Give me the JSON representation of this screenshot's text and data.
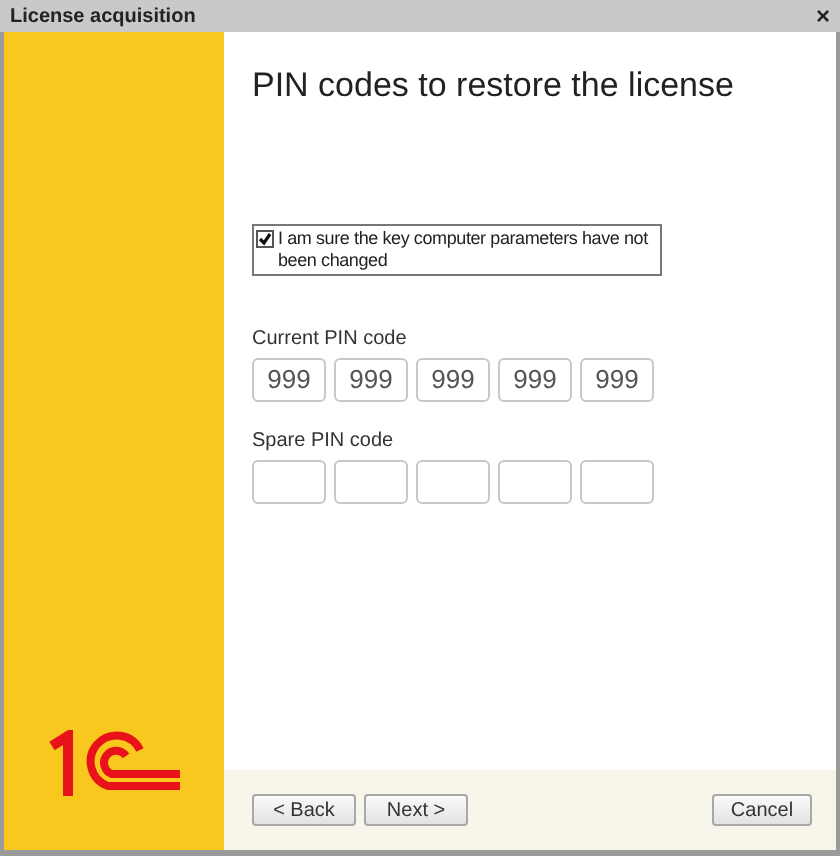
{
  "window": {
    "title": "License acquisition",
    "close": "×"
  },
  "heading": "PIN codes to restore the license",
  "confirm": {
    "label": "I am sure the key computer parameters have not been changed",
    "checked": true
  },
  "current_pin": {
    "label": "Current PIN code",
    "fields": [
      {
        "kind": "input",
        "value": "999"
      },
      {
        "kind": "input",
        "value": "999"
      },
      {
        "kind": "input",
        "value": "999"
      },
      {
        "kind": "input",
        "value": "999"
      },
      {
        "kind": "input",
        "value": "999"
      }
    ]
  },
  "spare_pin": {
    "label": "Spare PIN code",
    "fields": [
      {
        "kind": "input"
      },
      {
        "kind": "input"
      },
      {
        "kind": "input"
      },
      {
        "kind": "input"
      },
      {
        "kind": "input"
      }
    ]
  },
  "buttons": [
    {
      "label": "< Back",
      "kind": "back"
    },
    {
      "label": "Next >",
      "kind": "next"
    },
    {
      "label": "Cancel",
      "kind": "cancel"
    }
  ]
}
